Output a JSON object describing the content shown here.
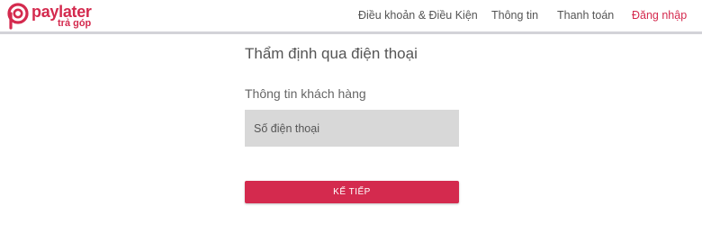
{
  "brand": {
    "name": "paylater",
    "tagline": "trả góp",
    "color": "#d42a4e"
  },
  "nav": {
    "items": [
      {
        "label": "Điều khoản & Điều Kiện",
        "active": false
      },
      {
        "label": "Thông tin",
        "active": false
      },
      {
        "label": "Thanh toán",
        "active": false
      },
      {
        "label": "Đăng nhập",
        "active": true
      }
    ]
  },
  "main": {
    "title": "Thẩm định qua điện thoại",
    "section_label": "Thông tin khách hàng",
    "phone_field": {
      "placeholder": "Số điện thoại",
      "value": ""
    },
    "next_button_label": "KẾ TIẾP"
  },
  "icons": {
    "logo": "paylater-logo-icon"
  }
}
